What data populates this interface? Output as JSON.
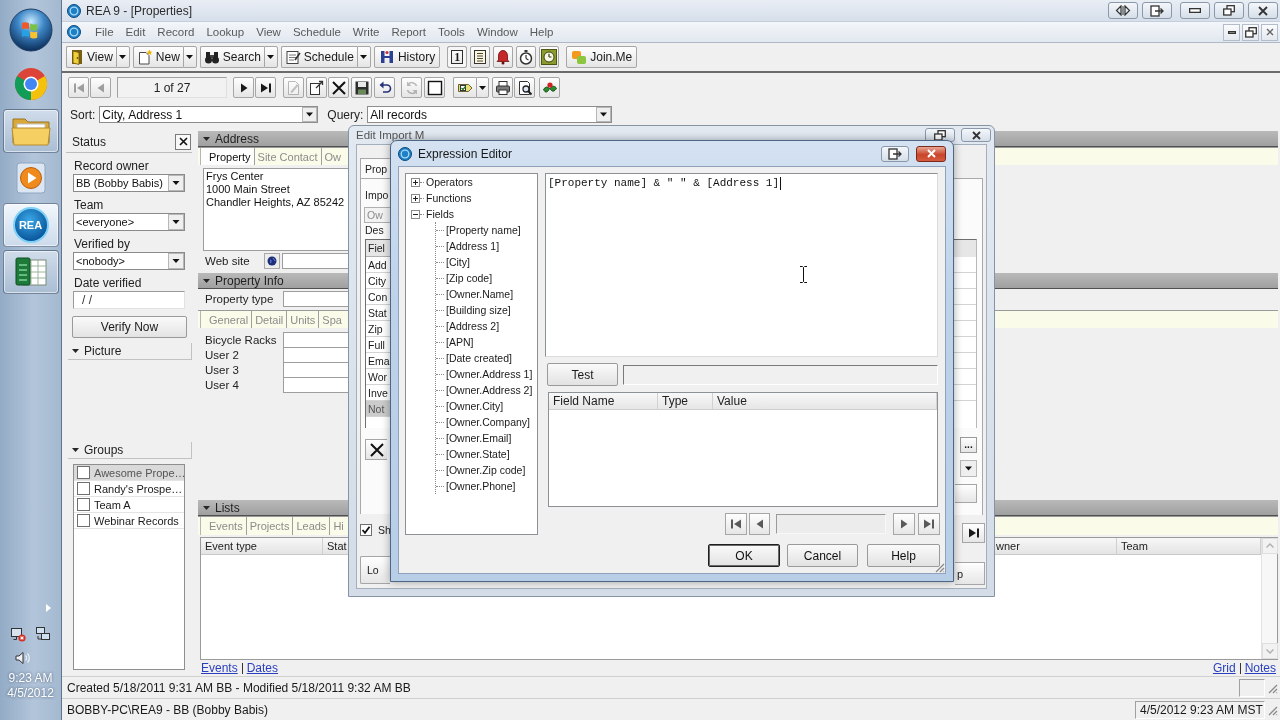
{
  "taskbar": {
    "items": [
      {
        "kind": "browser",
        "running": false,
        "selected": false
      },
      {
        "kind": "folder",
        "running": true,
        "selected": false
      },
      {
        "kind": "media",
        "running": false,
        "selected": false
      },
      {
        "kind": "rea",
        "label": "REA",
        "running": true,
        "selected": true
      },
      {
        "kind": "spreadsheet",
        "running": true,
        "selected": false
      }
    ],
    "clock": {
      "time": "9:23 AM",
      "date": "4/5/2012"
    }
  },
  "window": {
    "title": "REA 9 - [Properties]"
  },
  "menu": [
    "File",
    "Edit",
    "Record",
    "Lookup",
    "View",
    "Schedule",
    "Write",
    "Report",
    "Tools",
    "Window",
    "Help"
  ],
  "toolbar": [
    {
      "kind": "split",
      "label": "View"
    },
    {
      "kind": "split",
      "label": "New"
    },
    {
      "kind": "split",
      "label": "Search"
    },
    {
      "kind": "split",
      "label": "Schedule"
    },
    {
      "kind": "plain",
      "label": "History"
    },
    {
      "kind": "glyph",
      "label": "1"
    },
    {
      "kind": "icon"
    },
    {
      "kind": "icon"
    },
    {
      "kind": "icon"
    },
    {
      "kind": "icon"
    },
    {
      "kind": "plain",
      "label": "Join.Me"
    }
  ],
  "record_bar": {
    "navigation": [
      {
        "disabled": true
      },
      {
        "disabled": true
      },
      {
        "disabled": false
      },
      {
        "disabled": false
      }
    ],
    "position": "1 of 27",
    "actions": [
      {
        "kind": "button",
        "disabled": true
      },
      {
        "kind": "button",
        "disabled": false
      },
      {
        "kind": "button",
        "disabled": false
      },
      {
        "kind": "button",
        "disabled": false
      },
      {
        "kind": "button",
        "disabled": false
      },
      {
        "kind": "button",
        "disabled": true
      },
      {
        "kind": "button",
        "disabled": false
      },
      {
        "kind": "split",
        "disabled": false
      },
      {
        "kind": "button",
        "disabled": false
      },
      {
        "kind": "button",
        "disabled": false
      },
      {
        "kind": "button",
        "disabled": false
      }
    ]
  },
  "sort": {
    "label": "Sort:",
    "value": "City, Address 1"
  },
  "query": {
    "label": "Query:",
    "value": "All records"
  },
  "status_panel": {
    "title": "Status",
    "fields": [
      {
        "kind": "combo",
        "label": "Record owner",
        "value": "BB (Bobby Babis)"
      },
      {
        "kind": "combo",
        "label": "Team",
        "value": "<everyone>"
      },
      {
        "kind": "combo",
        "label": "Verified by",
        "value": "<nobody>"
      },
      {
        "kind": "text",
        "label": "Date verified",
        "value": "/ /"
      }
    ],
    "button": "Verify Now"
  },
  "picture_section": {
    "title": "Picture",
    "expanded": true
  },
  "groups_section": {
    "title": "Groups",
    "expanded": true,
    "items": [
      {
        "label": "Awesome Prope…",
        "checked": false,
        "selected": true
      },
      {
        "label": "Randy's Prospe…",
        "checked": false,
        "selected": false
      },
      {
        "label": "Team A",
        "checked": false,
        "selected": false
      },
      {
        "label": "Webinar Records",
        "checked": false,
        "selected": false
      }
    ]
  },
  "address_section": {
    "title": "Address",
    "expanded": true,
    "tabs": [
      {
        "label": "Property",
        "selected": true
      },
      {
        "label": "Site Contact",
        "selected": false
      },
      {
        "label": "Ow",
        "selected": false
      }
    ],
    "address": "Frys Center\n1000 Main Street\nChandler Heights, AZ 85242",
    "web_site_label": "Web site"
  },
  "property_info_section": {
    "title": "Property Info",
    "expanded": true,
    "property_type_label": "Property type",
    "tabs": [
      {
        "label": "General",
        "selected": false
      },
      {
        "label": "Detail",
        "selected": false
      },
      {
        "label": "Units",
        "selected": false
      },
      {
        "label": "Spa",
        "selected": false
      }
    ],
    "fields": [
      "Bicycle Racks",
      "User 2",
      "User 3",
      "User 4"
    ]
  },
  "lists_section": {
    "title": "Lists",
    "expanded": true,
    "tabs": [
      {
        "label": "Events",
        "selected": false
      },
      {
        "label": "Projects",
        "selected": false
      },
      {
        "label": "Leads",
        "selected": false
      },
      {
        "label": "Hi",
        "selected": false
      }
    ],
    "columns": [
      "Event type",
      "Stat",
      "wner",
      "Team"
    ],
    "links_left": [
      "Events",
      "Dates"
    ],
    "links_right": [
      "Grid",
      "Notes"
    ]
  },
  "status_bar": {
    "record_info": "Created 5/18/2011 9:31 AM BB - Modified 5/18/2011 9:32 AM BB",
    "connection": "BOBBY-PC\\REA9 - BB (Bobby Babis)",
    "date_time": "4/5/2012 9:23 AM MST"
  },
  "edit_import_dialog": {
    "title": "Edit Import M",
    "tab": {
      "label": "Prop",
      "selected": true
    },
    "import_label": "Impo",
    "owner_field": {
      "value": "Ow",
      "disabled": true
    },
    "description_label": "Des",
    "grid": {
      "header": "Fiel",
      "rows": [
        {
          "text": "Add",
          "selected": false
        },
        {
          "text": "City",
          "selected": false
        },
        {
          "text": "Con",
          "selected": false
        },
        {
          "text": "Stat",
          "selected": false
        },
        {
          "text": "Zip",
          "selected": false
        },
        {
          "text": "Full",
          "selected": false
        },
        {
          "text": "Ema",
          "selected": false
        },
        {
          "text": "Wor",
          "selected": false
        },
        {
          "text": "Inve",
          "selected": false
        },
        {
          "text": "Not",
          "selected": true
        }
      ]
    },
    "show_checkbox": {
      "label": "Sh",
      "checked": true
    },
    "left_button": "Lo",
    "browse_button": "...",
    "right_button": "p"
  },
  "expression_editor": {
    "title": "Expression Editor",
    "tree": [
      {
        "label": "Operators",
        "expanded": false
      },
      {
        "label": "Functions",
        "expanded": false
      },
      {
        "label": "Fields",
        "expanded": true,
        "children": [
          {
            "label": "[Property name]"
          },
          {
            "label": "[Address 1]"
          },
          {
            "label": "[City]"
          },
          {
            "label": "[Zip code]"
          },
          {
            "label": "[Owner.Name]"
          },
          {
            "label": "[Building size]"
          },
          {
            "label": "[Address 2]"
          },
          {
            "label": "[APN]"
          },
          {
            "label": "[Date created]"
          },
          {
            "label": "[Owner.Address 1]"
          },
          {
            "label": "[Owner.Address 2]"
          },
          {
            "label": "[Owner.City]"
          },
          {
            "label": "[Owner.Company]"
          },
          {
            "label": "[Owner.Email]"
          },
          {
            "label": "[Owner.State]"
          },
          {
            "label": "[Owner.Zip code]"
          },
          {
            "label": "[Owner.Phone]"
          }
        ]
      }
    ],
    "expression": "[Property name] & \" \" & [Address 1]",
    "test_button": "Test",
    "columns": [
      "Field Name",
      "Type",
      "Value"
    ],
    "buttons": [
      {
        "label": "OK",
        "default": true
      },
      {
        "label": "Cancel",
        "default": false
      },
      {
        "label": "Help",
        "default": false
      }
    ]
  }
}
